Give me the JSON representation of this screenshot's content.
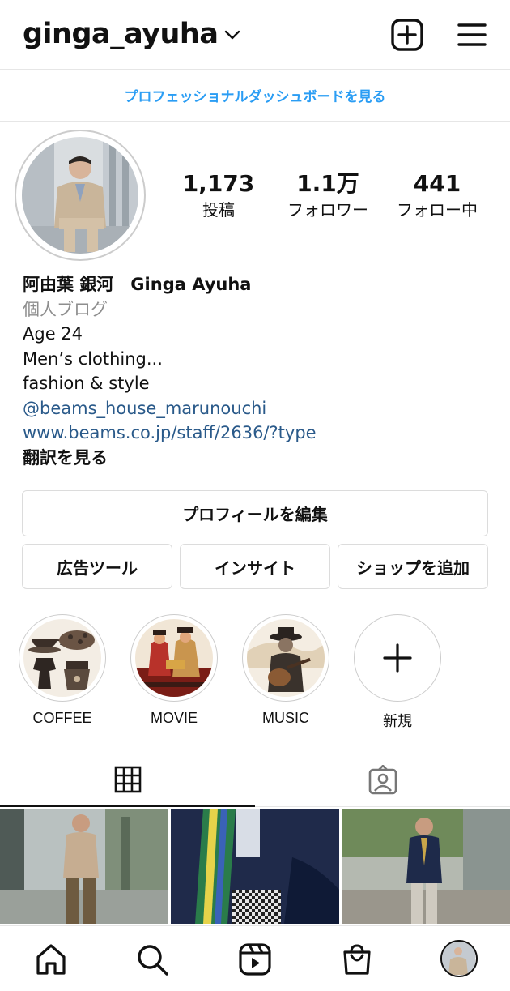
{
  "header": {
    "username": "ginga_ayuha",
    "dropdown_icon": "chevron-down-icon",
    "create_icon": "plus-square-icon",
    "menu_icon": "hamburger-menu-icon"
  },
  "dashboard_link": "プロフェッショナルダッシュボードを見る",
  "stats": [
    {
      "value": "1,173",
      "label": "投稿"
    },
    {
      "value": "1.1万",
      "label": "フォロワー"
    },
    {
      "value": "441",
      "label": "フォロー中"
    }
  ],
  "bio": {
    "name": "阿由葉 銀河　Ginga Ayuha",
    "category": "個人ブログ",
    "lines": [
      "Age 24",
      "Men’s clothing...",
      "fashion & style"
    ],
    "mention": "@beams_house_marunouchi",
    "website": "www.beams.co.jp/staff/2636/?type",
    "translate": "翻訳を見る"
  },
  "buttons": {
    "edit_profile": "プロフィールを編集",
    "ad_tools": "広告ツール",
    "insights": "インサイト",
    "add_shop": "ショップを追加"
  },
  "highlights": [
    {
      "label": "COFFEE"
    },
    {
      "label": "MOVIE"
    },
    {
      "label": "MUSIC"
    },
    {
      "label": "新規"
    }
  ],
  "tabs": {
    "grid_icon": "grid-icon",
    "tagged_icon": "tagged-person-icon"
  },
  "nav": [
    "home-icon",
    "search-icon",
    "reels-icon",
    "shop-bag-icon",
    "profile-avatar"
  ],
  "colors": {
    "accent_link": "#2a9df4",
    "bio_link": "#2a5a8a",
    "secondary_text": "#8e8e8e",
    "border": "#dcdcdc"
  }
}
